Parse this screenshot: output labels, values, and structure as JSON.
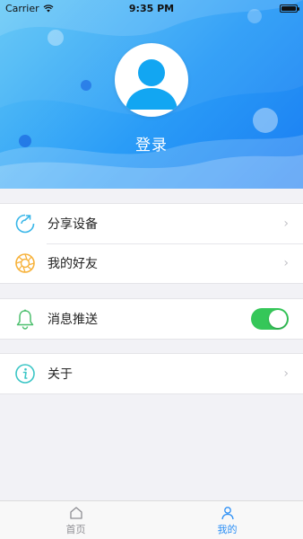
{
  "status_bar": {
    "carrier": "Carrier",
    "time": "9:35 PM"
  },
  "header": {
    "login_label": "登录"
  },
  "menu": {
    "group1": [
      {
        "label": "分享设备",
        "icon": "share-refresh-icon"
      },
      {
        "label": "我的好友",
        "icon": "aperture-icon"
      }
    ],
    "group2": [
      {
        "label": "消息推送",
        "icon": "bell-icon",
        "toggle_on": true
      }
    ],
    "group3": [
      {
        "label": "关于",
        "icon": "info-icon"
      }
    ]
  },
  "tab_bar": {
    "tabs": [
      {
        "label": "首页",
        "icon": "home-icon",
        "active": false
      },
      {
        "label": "我的",
        "icon": "user-icon",
        "active": true
      }
    ]
  },
  "colors": {
    "header_start": "#5ec6f6",
    "header_end": "#1a7df2",
    "accent": "#2a8ef5",
    "toggle_on": "#35c759",
    "friends_icon": "#f7b23b",
    "bell_icon": "#4cbf6d",
    "info_icon": "#3cc6c6"
  }
}
